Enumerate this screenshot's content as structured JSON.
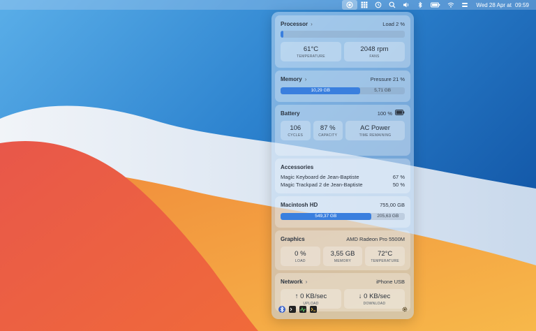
{
  "menubar": {
    "date": "Wed 28 Apr at",
    "time": "09:59"
  },
  "processor": {
    "title": "Processor",
    "load_label": "Load 2 %",
    "load_fraction": 0.02,
    "temperature": {
      "value": "61°C",
      "label": "TEMPERATURE"
    },
    "fans": {
      "value": "2048 rpm",
      "label": "FANS"
    }
  },
  "memory": {
    "title": "Memory",
    "pressure_label": "Pressure 21 %",
    "used": "10,29 GB",
    "free": "5,71 GB",
    "used_fraction": 0.643
  },
  "battery": {
    "title": "Battery",
    "percent": "100 %",
    "cycles": {
      "value": "106",
      "label": "CYCLES"
    },
    "capacity": {
      "value": "87 %",
      "label": "CAPACITY"
    },
    "power": {
      "value": "AC Power",
      "label": "TIME REMAINING"
    }
  },
  "accessories": {
    "title": "Accessories",
    "items": [
      {
        "name": "Magic Keyboard de Jean-Baptiste",
        "level": "67 %"
      },
      {
        "name": "Magic Trackpad 2 de Jean-Baptiste",
        "level": "50 %"
      }
    ]
  },
  "disk": {
    "title": "Macintosh HD",
    "total": "755,00 GB",
    "used": "549,37 GB",
    "free": "205,63 GB",
    "used_fraction": 0.728
  },
  "graphics": {
    "title": "Graphics",
    "gpu": "AMD Radeon Pro 5500M",
    "load": {
      "value": "0 %",
      "label": "LOAD"
    },
    "memory": {
      "value": "3,55 GB",
      "label": "MEMORY"
    },
    "temperature": {
      "value": "72°C",
      "label": "TEMPERATURE"
    }
  },
  "network": {
    "title": "Network",
    "interface": "iPhone USB",
    "upload": {
      "value": "↑ 0 KB/sec",
      "label": "UPLOAD"
    },
    "download": {
      "value": "↓ 0 KB/sec",
      "label": "DOWNLOAD"
    }
  },
  "colors": {
    "accent": "#3a7fde"
  }
}
